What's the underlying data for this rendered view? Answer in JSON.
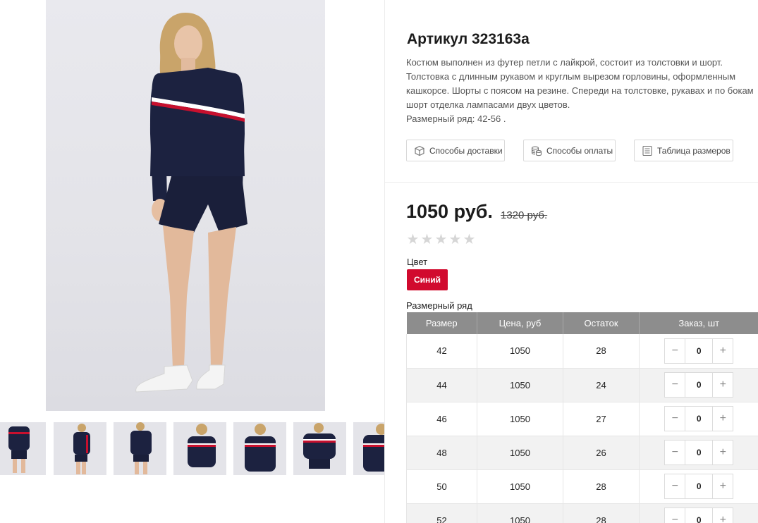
{
  "product": {
    "title": "Артикул 323163а",
    "description_lines": [
      "Костюм выполнен из футер петли с лайкрой, состоит из толстовки и шорт.",
      "Толстовка с длинным рукавом и круглым вырезом горловины, оформленным",
      "кашкорсе. Шорты с поясом на резине. Спереди на толстовке, рукавах и по бокам",
      "шорт отделка лампасами двух цветов.",
      "Размерный ряд: 42-56 ."
    ],
    "info_buttons": [
      {
        "label": "Способы доставки",
        "icon": "box-icon"
      },
      {
        "label": "Способы оплаты",
        "icon": "coins-icon"
      },
      {
        "label": "Таблица размеров",
        "icon": "size-chart-icon"
      }
    ],
    "price": "1050 руб.",
    "old_price": "1320 руб.",
    "rating": {
      "value": 0,
      "max": 5
    },
    "color_label": "Цвет",
    "selected_color": "Синий",
    "size_range_label": "Размерный ряд"
  },
  "size_table": {
    "headers": [
      "Размер",
      "Цена, руб",
      "Остаток",
      "Заказ, шт"
    ],
    "rows": [
      {
        "size": "42",
        "price": "1050",
        "stock": "28",
        "qty": "0"
      },
      {
        "size": "44",
        "price": "1050",
        "stock": "24",
        "qty": "0"
      },
      {
        "size": "46",
        "price": "1050",
        "stock": "27",
        "qty": "0"
      },
      {
        "size": "48",
        "price": "1050",
        "stock": "26",
        "qty": "0"
      },
      {
        "size": "50",
        "price": "1050",
        "stock": "28",
        "qty": "0"
      },
      {
        "size": "52",
        "price": "1050",
        "stock": "28",
        "qty": "0"
      }
    ],
    "minus": "−",
    "plus": "+"
  },
  "colors": {
    "accent": "#d10a2e",
    "table_header": "#8d8d8d",
    "garment": "#1c2240",
    "stripe_red": "#c8102e"
  }
}
